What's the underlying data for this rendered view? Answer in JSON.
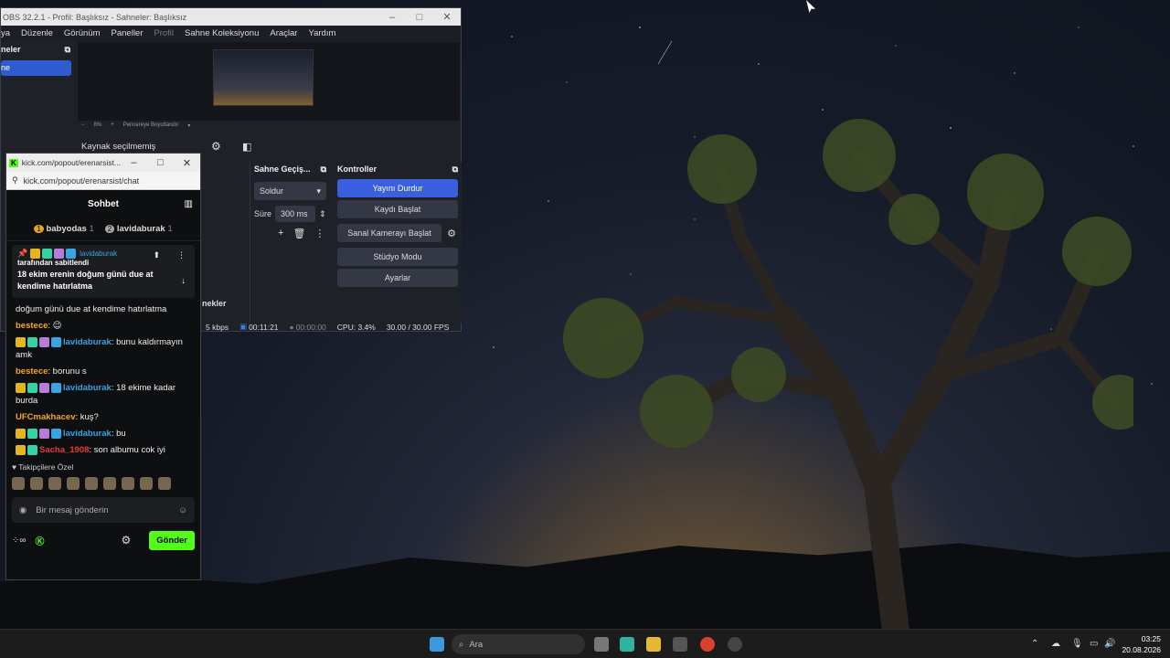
{
  "obs": {
    "title": "OBS 32.2.1 - Profil: Başlıksız - Sahneler: Başlıksız",
    "menu": [
      "ya",
      "Düzenle",
      "Görünüm",
      "Paneller",
      "Profil",
      "Sahne Koleksiyonu",
      "Araçlar",
      "Yardım"
    ],
    "scenes_header": "neler",
    "scene_selected": "ne",
    "zoom": "8%",
    "zoom_mode": "Pencereye Boyutlandır",
    "source_status": "Kaynak seçilmemiş",
    "transitions_header": "Sahne Geçiş...",
    "transition_value": "Soldur",
    "duration_label": "Süre",
    "duration_value": "300 ms",
    "scenes_bottom": "nekler",
    "controls_header": "Kontroller",
    "controls": [
      "Yayını Durdur",
      "Kaydı Başlat",
      "Sanal Kamerayı Başlat",
      "Stüdyo Modu",
      "Ayarlar"
    ],
    "status": {
      "bitrate": "5 kbps",
      "live_time": "00:11:21",
      "rec_time": "00:00:00",
      "cpu": "CPU: 3.4%",
      "fps": "30.00 / 30.00 FPS"
    }
  },
  "kick": {
    "window_title": "kick.com/popout/erenarsist...",
    "url": "kick.com/popout/erenarsist/chat",
    "header": "Sohbet",
    "leaders": [
      {
        "rank": "1",
        "name": "babyodas",
        "count": "1"
      },
      {
        "rank": "2",
        "name": "lavidaburak",
        "count": "1"
      }
    ],
    "pinned": {
      "user": "lavidaburak",
      "by": "tarafından sabitlendi",
      "message": "18 ekim erenin doğum günü due at kendime hatırlatma"
    },
    "messages": [
      {
        "user": "",
        "text": "doğum günü due at kendime hatırlatma",
        "color": "#eeeeee"
      },
      {
        "user": "bestece",
        "text": ": 😉",
        "color": "#f5a623"
      },
      {
        "user": "lavidaburak",
        "text": ": bunu kaldırmayın amk",
        "color": "#3aa4e0"
      },
      {
        "user": "bestece",
        "text": ": borunu s",
        "color": "#f5a623"
      },
      {
        "user": "lavidaburak",
        "text": ": 18 ekime kadar burda",
        "color": "#3aa4e0"
      },
      {
        "user": "UFCmakhacev",
        "text": ": kuş?",
        "color": "#f5a623"
      },
      {
        "user": "lavidaburak",
        "text": ": bu",
        "color": "#3aa4e0"
      },
      {
        "user": "Sacha_1908",
        "text": ": son albumu cok iyi",
        "color": "#e83a3a"
      }
    ],
    "followers_label": "Takipçilere Özel",
    "input_placeholder": "Bir mesaj gönderin",
    "send": "Gönder"
  },
  "taskbar": {
    "search": "Ara",
    "time": "03:25",
    "date": "20.08.2026"
  }
}
